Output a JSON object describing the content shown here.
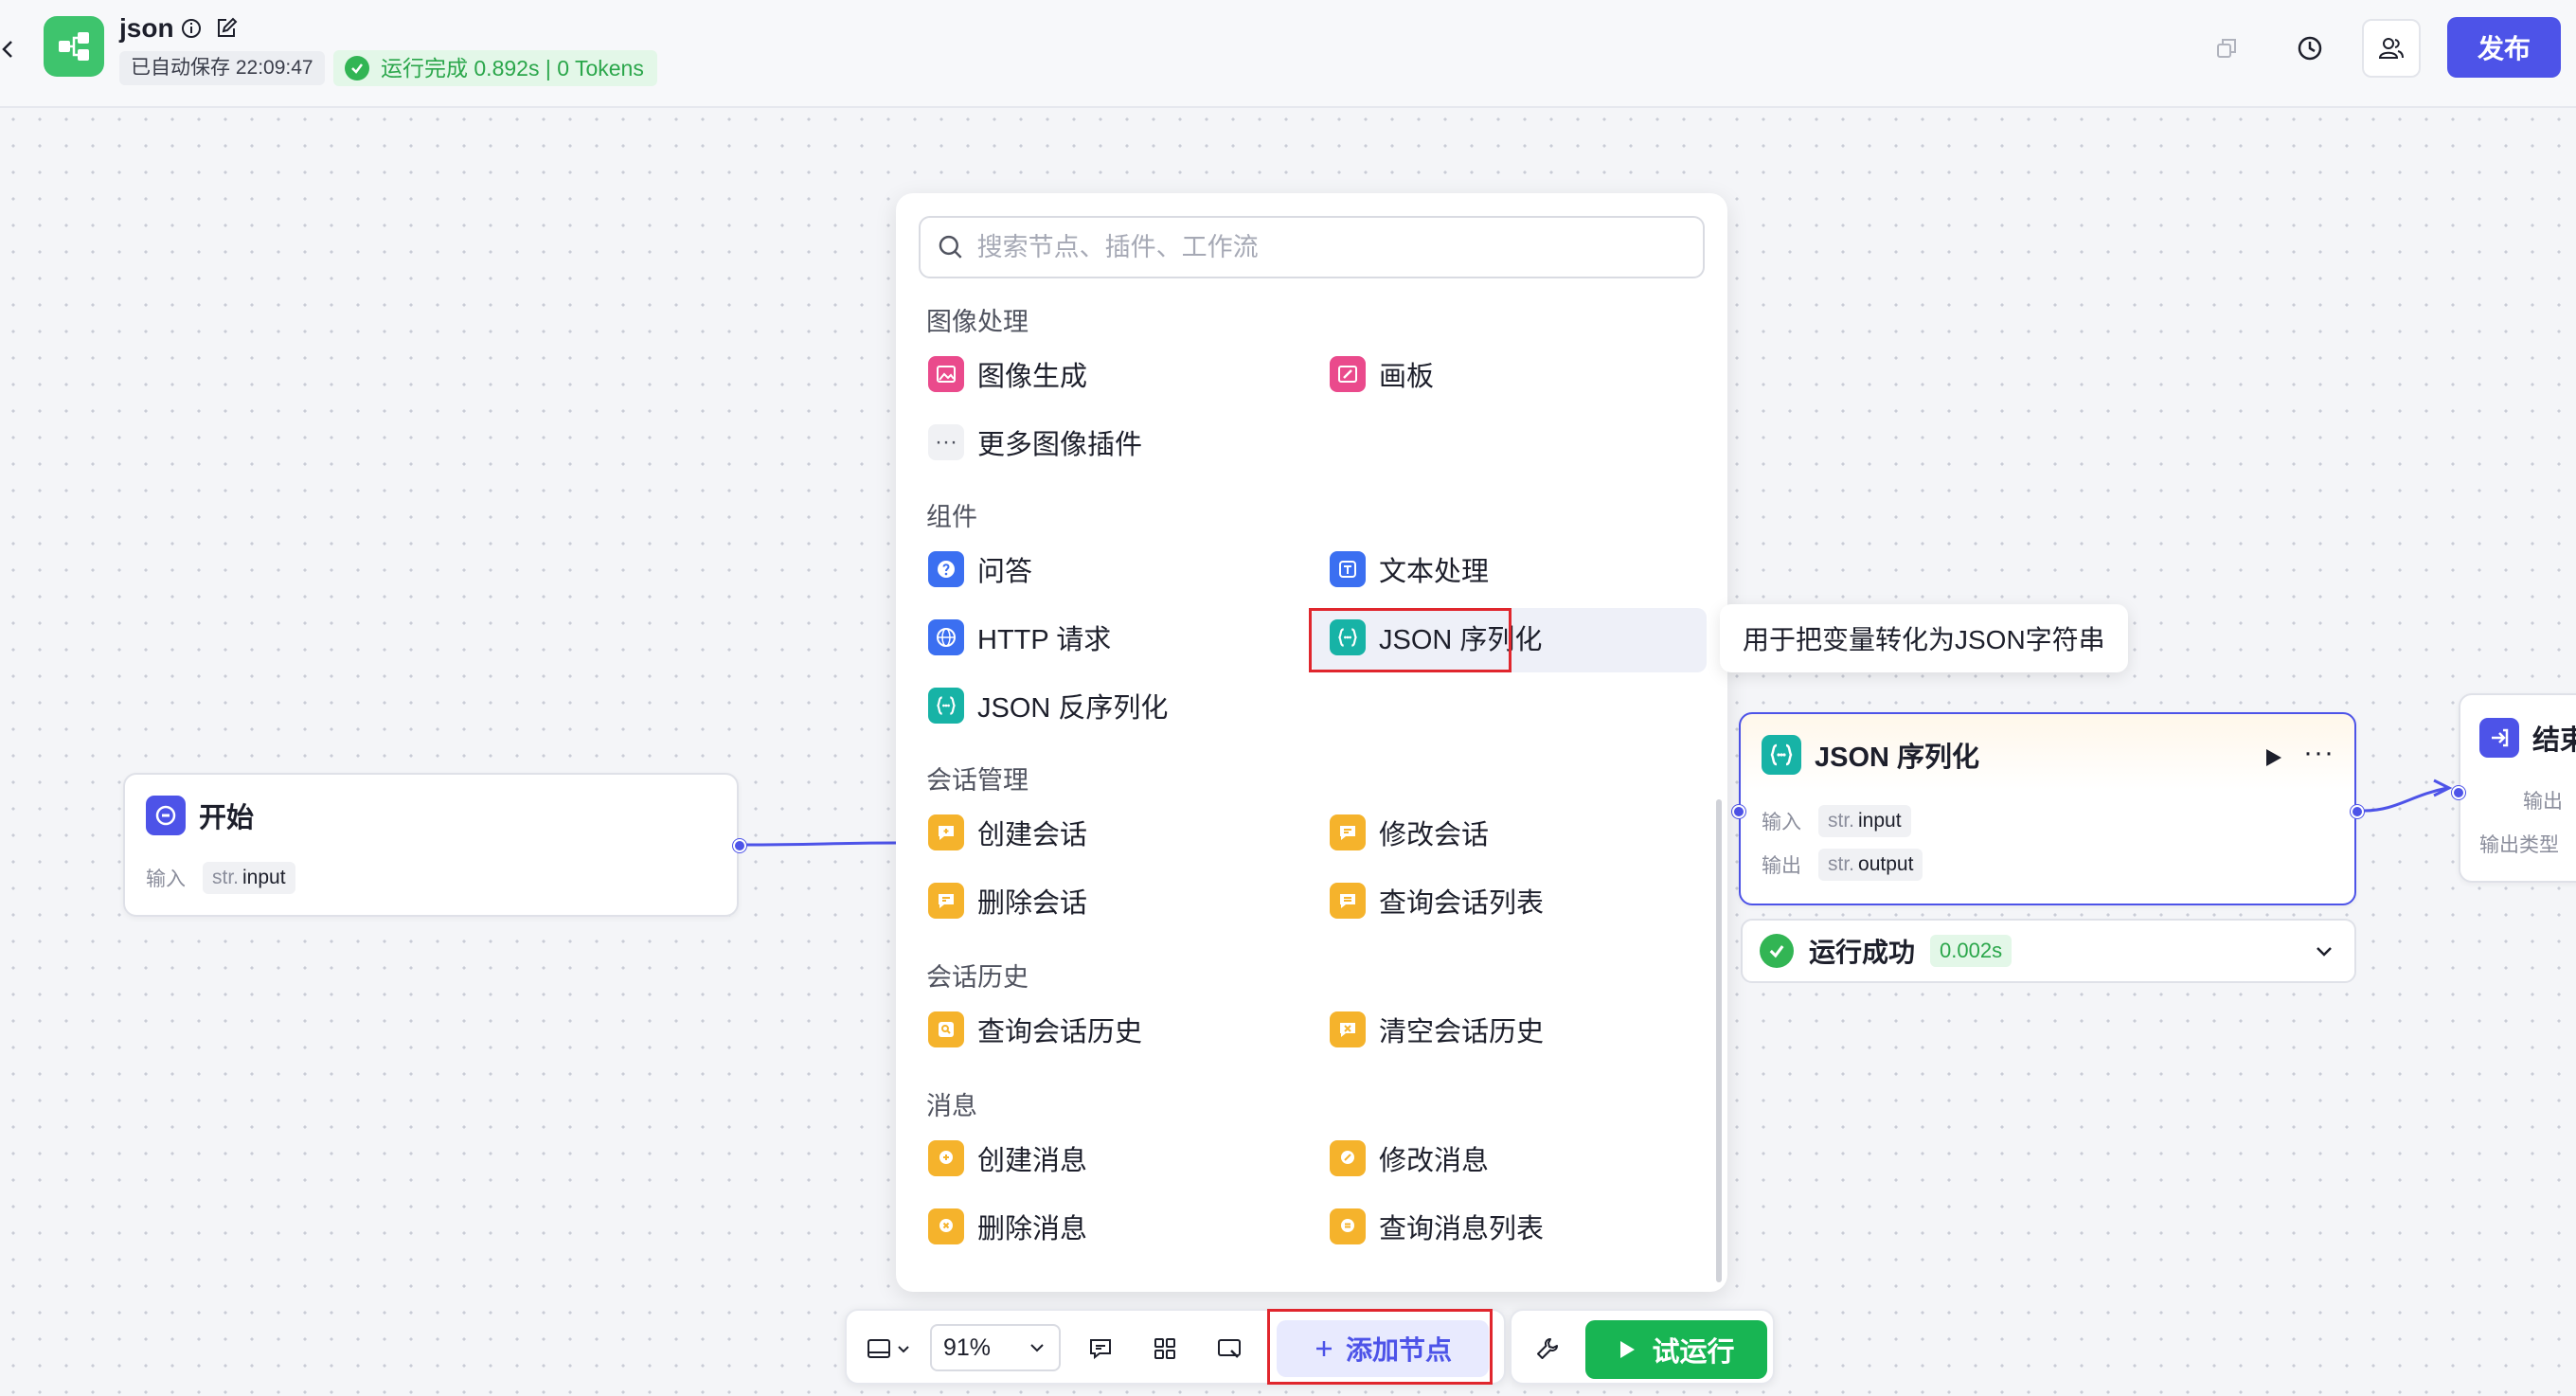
{
  "header": {
    "title": "json",
    "autosave": "已自动保存 22:09:47",
    "run_status": "运行完成 0.892s | 0 Tokens",
    "publish_label": "发布"
  },
  "picker": {
    "search_placeholder": "搜索节点、插件、工作流",
    "sections": {
      "image": "图像处理",
      "components": "组件",
      "conversation": "会话管理",
      "history": "会话历史",
      "message": "消息"
    },
    "items": {
      "image_gen": "图像生成",
      "canvas": "画板",
      "more_image": "更多图像插件",
      "qa": "问答",
      "text_process": "文本处理",
      "http": "HTTP 请求",
      "json_serialize": "JSON 序列化",
      "json_deserialize": "JSON 反序列化",
      "create_conv": "创建会话",
      "edit_conv": "修改会话",
      "delete_conv": "删除会话",
      "query_conv_list": "查询会话列表",
      "query_history": "查询会话历史",
      "clear_history": "清空会话历史",
      "create_msg": "创建消息",
      "edit_msg": "修改消息",
      "delete_msg": "删除消息",
      "query_msg_list": "查询消息列表"
    },
    "tooltip": "用于把变量转化为JSON字符串"
  },
  "nodes": {
    "start": {
      "title": "开始",
      "input_label": "输入",
      "type": "str.",
      "var": "input"
    },
    "json": {
      "title": "JSON 序列化",
      "input_label": "输入",
      "input_type": "str.",
      "input_var": "input",
      "output_label": "输出",
      "output_type": "str.",
      "output_var": "output",
      "run_result": "运行成功",
      "run_time": "0.002s"
    },
    "end": {
      "title": "结束",
      "output_label": "输出",
      "output_type_label": "输出类型"
    }
  },
  "toolbar": {
    "zoom": "91%",
    "add_node": "添加节点",
    "trial_run": "试运行"
  },
  "colors": {
    "accent": "#4d53e8",
    "success": "#18b553",
    "highlight_box": "#e0262d"
  }
}
